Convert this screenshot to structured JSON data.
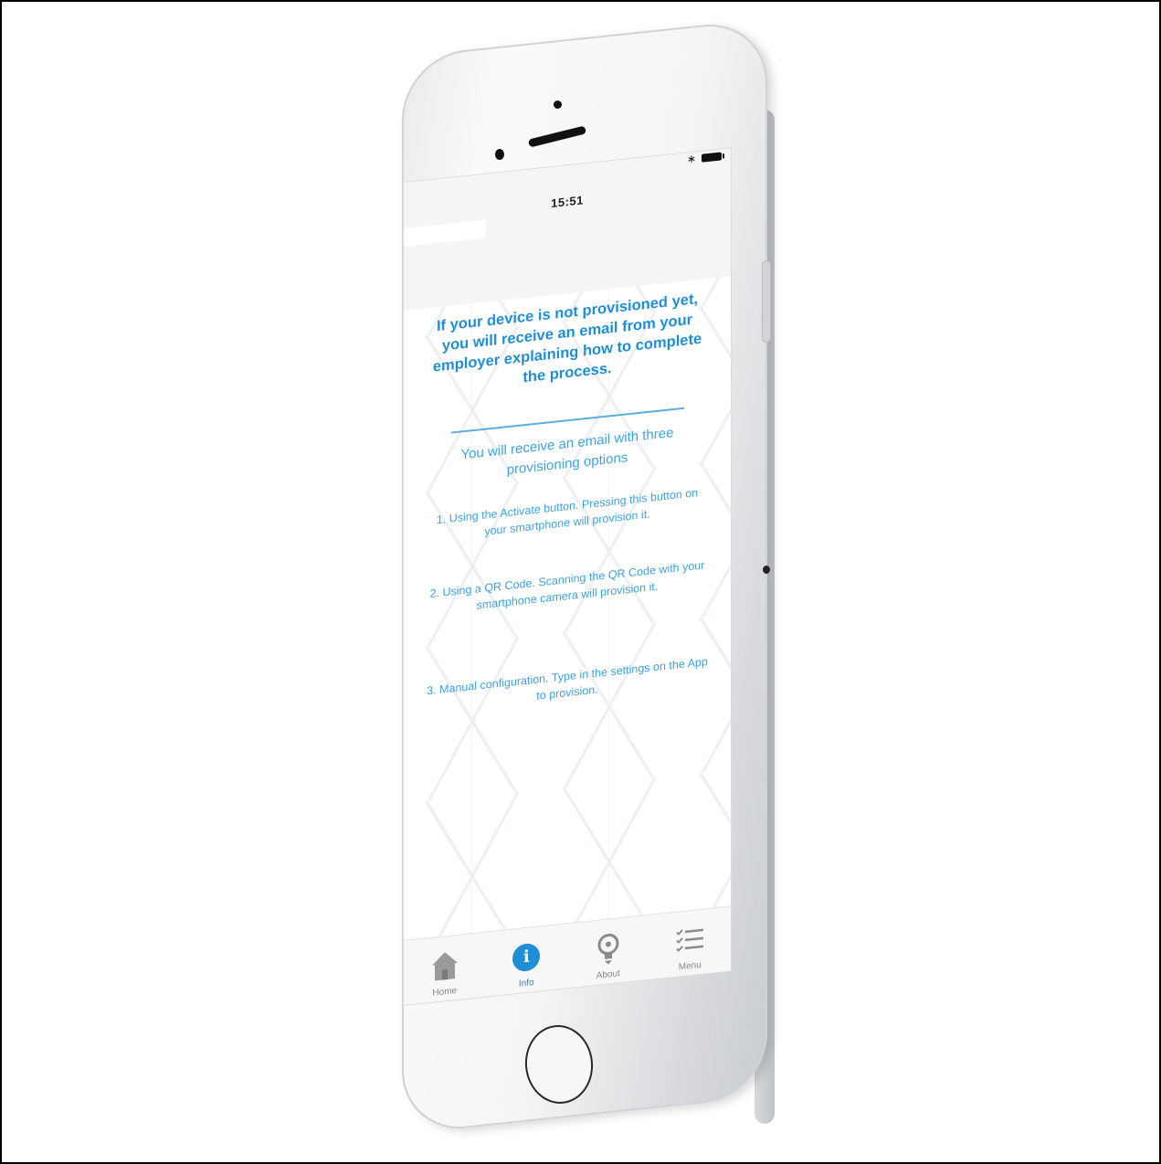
{
  "status_bar": {
    "time": "15:51",
    "bluetooth_icon": "bluetooth-icon",
    "battery_icon": "battery-icon"
  },
  "main": {
    "headline": "If your device is not provisioned yet, you will receive an email from your employer explaining how to complete the process.",
    "subhead": "You will receive an email with three provisioning options",
    "options": [
      "1. Using the Activate button. Pressing this button on your smartphone will provision it.",
      "2. Using a QR Code. Scanning the QR Code with your smartphone camera will provision it.",
      "3. Manual configuration. Type in the settings on the App to provision."
    ]
  },
  "tabs": [
    {
      "label": "Home",
      "icon": "home-icon",
      "active": false
    },
    {
      "label": "Info",
      "icon": "info-icon",
      "active": true
    },
    {
      "label": "About",
      "icon": "lightbulb-icon",
      "active": false
    },
    {
      "label": "Menu",
      "icon": "checklist-icon",
      "active": false
    }
  ],
  "colors": {
    "accent": "#1e8fd6",
    "tab_inactive": "#8a8a8a"
  }
}
